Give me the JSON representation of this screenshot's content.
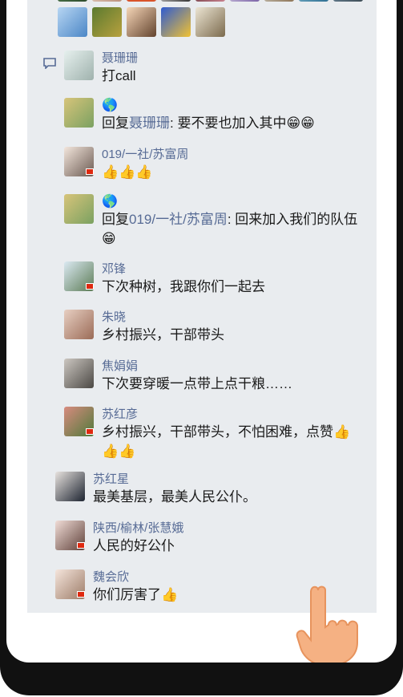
{
  "comments": [
    {
      "name": "聂珊珊",
      "text": "打call"
    },
    {
      "name": "🌎",
      "text_prefix": "回复",
      "reply_to": "聂珊珊",
      "text": ": 要不要也加入其中😁😁"
    },
    {
      "name": "019/一社/苏富周",
      "text": "👍👍👍"
    },
    {
      "name": "🌎",
      "text_prefix": "回复",
      "reply_to": "019/一社/苏富周",
      "text": ": 回来加入我们的队伍",
      "text2": "😁"
    },
    {
      "name": "邓锋",
      "text": "下次种树，我跟你们一起去"
    },
    {
      "name": "朱晓",
      "text": "乡村振兴，干部带头"
    },
    {
      "name": "焦娟娟",
      "text": "下次要穿暖一点带上点干粮……"
    },
    {
      "name": "苏红彦",
      "text": "乡村振兴，干部带头，不怕困难，点赞👍",
      "text2": "👍👍"
    },
    {
      "name": "苏红星",
      "text": "最美基层，最美人民公仆。"
    },
    {
      "name": "陕西/榆林/张慧娥",
      "text": "人民的好公仆"
    },
    {
      "name": "魏会欣",
      "text": "你们厉害了👍"
    }
  ],
  "icons": {
    "comment": "comment-bubble-icon",
    "hand": "pointing-hand-icon",
    "globe": "globe-icon"
  },
  "colors": {
    "name": "#576b95",
    "panel": "#e9ecef"
  }
}
